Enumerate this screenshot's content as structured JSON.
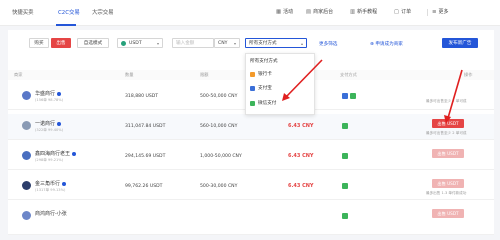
{
  "nav": {
    "items": [
      {
        "label": "快捷买卖",
        "active": false
      },
      {
        "label": "C2C交易",
        "active": true
      },
      {
        "label": "大宗交易",
        "active": false
      }
    ],
    "links": [
      {
        "label": "活动",
        "icon": "activity-icon"
      },
      {
        "label": "商家后台",
        "icon": "store-icon"
      },
      {
        "label": "新手教程",
        "icon": "book-icon"
      },
      {
        "label": "订单",
        "icon": "order-icon"
      },
      {
        "label": "更多",
        "icon": "menu-icon"
      }
    ]
  },
  "filters": {
    "buy_label": "购买",
    "sell_label": "出售",
    "mode_label": "自选模式",
    "coin": "USDT",
    "amount_placeholder": "输入金额",
    "currency": "CNY",
    "payment_label": "所有支付方式",
    "more_filter": "更多筛选",
    "become_merchant": "申请成为商家",
    "post_ad": "发布新广告"
  },
  "dropdown": {
    "items": [
      {
        "label": "所有支付方式",
        "color": ""
      },
      {
        "label": "银行卡",
        "color": "#f39a2b"
      },
      {
        "label": "支付宝",
        "color": "#3a6fd8"
      },
      {
        "label": "微信支付",
        "color": "#3cb45a"
      }
    ]
  },
  "table": {
    "headers": {
      "merchant": "商家",
      "quantity": "数量",
      "limit": "限额",
      "price": "单价",
      "payment": "支付方式",
      "action": "操作"
    },
    "rows": [
      {
        "name": "华盛商行",
        "stats": "(156单 98.78%)",
        "quantity": "318,880 USDT",
        "limit": "500-50,000 CNY",
        "price": "",
        "payments": [
          "blue",
          "green"
        ],
        "action": "",
        "limit_note": "最多可出售至少 2 单可成"
      },
      {
        "name": "一诺商行",
        "stats": "(322单 99.40%)",
        "quantity": "311,047.84 USDT",
        "limit": "560-10,000 CNY",
        "price": "6.43 CNY",
        "payments": [
          "green"
        ],
        "action": "出售 USDT",
        "limit_note": "最多可出售至少 2 单可成"
      },
      {
        "name": "鑫四海商行老王",
        "stats": "(298单 99.21%)",
        "quantity": "294,145.69 USDT",
        "limit": "1,000-50,000 CNY",
        "price": "6.43 CNY",
        "payments": [
          "green"
        ],
        "action": "出售 USDT",
        "limit_note": ""
      },
      {
        "name": "金三角币行",
        "stats": "(1317单 99.13%)",
        "quantity": "99,762.26 USDT",
        "limit": "500-30,000 CNY",
        "price": "6.43 CNY",
        "payments": [
          "green"
        ],
        "action": "出售 USDT",
        "limit_note": "最多出售 1.3 单付款成功"
      },
      {
        "name": "商鸿商行-小张",
        "stats": "",
        "quantity": "",
        "limit": "",
        "price": "",
        "payments": [
          "green"
        ],
        "action": "出售 USDT",
        "limit_note": ""
      }
    ]
  }
}
